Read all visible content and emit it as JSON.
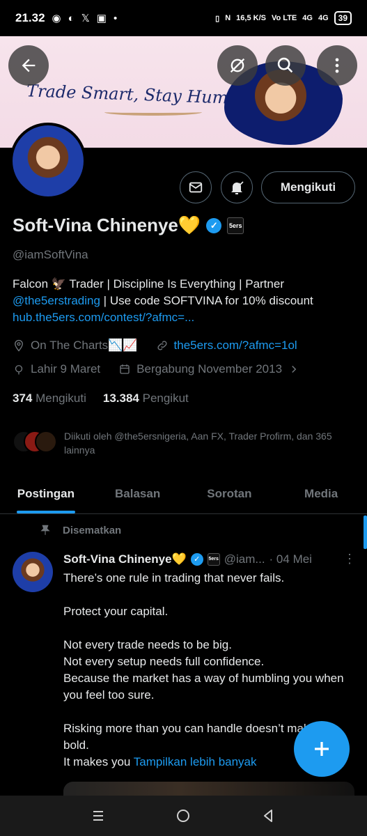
{
  "status_bar": {
    "time": "21.32",
    "net_speed": "16,5",
    "net_unit": "K/S",
    "volte": "Vo LTE",
    "sig1": "4G",
    "sig2": "4G",
    "battery": "39"
  },
  "banner": {
    "tagline": "Trade Smart, Stay Humble"
  },
  "profile": {
    "name": "Soft-Vina Chinenye💛",
    "handle": "@iamSoftVina",
    "follow_button": "Mengikuti",
    "org_badge": "5ers",
    "bio_line1_pre": "Falcon 🦅 Trader | Discipline Is Everything | Partner",
    "bio_mention": "@the5erstrading",
    "bio_line2_post": " | Use code SOFTVINA for 10% discount",
    "bio_link": "hub.the5ers.com/contest/?afmc=...",
    "location": "On The Charts📉📈",
    "website": "the5ers.com/?afmc=1ol",
    "birth": "Lahir 9 Maret",
    "joined": "Bergabung November 2013",
    "following_count": "374",
    "following_label": "Mengikuti",
    "followers_count": "13.384",
    "followers_label": "Pengikut",
    "followed_by": "Diikuti oleh @the5ersnigeria, Aan FX, Trader Profirm, dan 365 lainnya"
  },
  "tabs": [
    "Postingan",
    "Balasan",
    "Sorotan",
    "Media"
  ],
  "post": {
    "pinned_label": "Disematkan",
    "name": "Soft-Vina Chinenye💛",
    "handle": "@iam...",
    "date": "· 04 Mei",
    "org_badge": "5ers",
    "para1": "There’s one rule in trading that never fails.",
    "para2": "Protect your capital.",
    "para3_l1": "Not every trade needs to be big.",
    "para3_l2": "Not every setup needs full confidence.",
    "para3_l3": "Because the market has a way of humbling you when you feel too sure.",
    "para4": "Risking more than you can handle doesn’t make you bold.",
    "para5_pre": "It makes you ",
    "show_more": "Tampilkan lebih banyak"
  },
  "colors": {
    "accent": "#1d9bf0",
    "background": "#000000",
    "muted": "#71767b"
  }
}
